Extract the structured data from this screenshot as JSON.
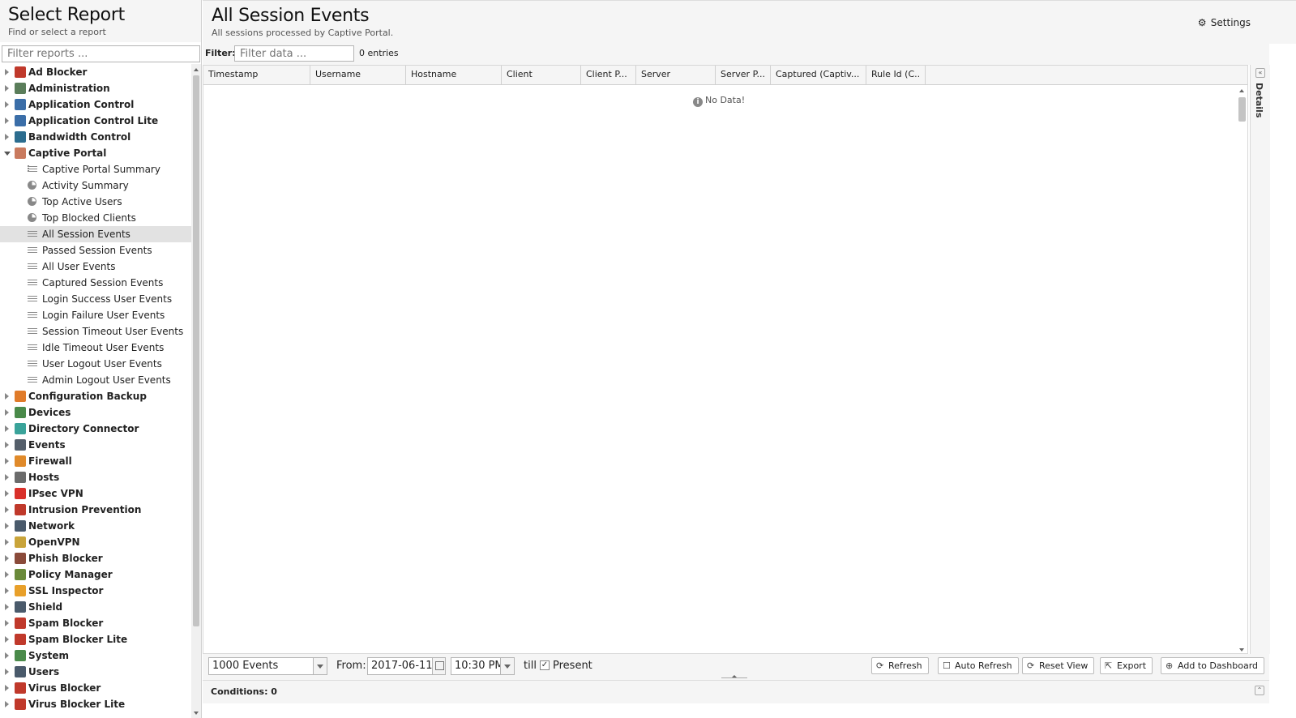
{
  "sidebar": {
    "title": "Select Report",
    "subtitle": "Find or select a report",
    "filter_placeholder": "Filter reports ...",
    "items": [
      {
        "label": "Ad Blocker",
        "type": "parent",
        "color": "#c0392b"
      },
      {
        "label": "Administration",
        "type": "parent",
        "color": "#5a7d5a"
      },
      {
        "label": "Application Control",
        "type": "parent",
        "color": "#3b6ea8"
      },
      {
        "label": "Application Control Lite",
        "type": "parent",
        "color": "#3b6ea8"
      },
      {
        "label": "Bandwidth Control",
        "type": "parent",
        "color": "#2c6d8f"
      },
      {
        "label": "Captive Portal",
        "type": "parent",
        "expanded": true,
        "color": "#c97a5e"
      },
      {
        "label": "Captive Portal Summary",
        "type": "child",
        "icon": "lines"
      },
      {
        "label": "Activity Summary",
        "type": "child",
        "icon": "pie"
      },
      {
        "label": "Top Active Users",
        "type": "child",
        "icon": "pie"
      },
      {
        "label": "Top Blocked Clients",
        "type": "child",
        "icon": "pie"
      },
      {
        "label": "All Session Events",
        "type": "child",
        "icon": "list",
        "selected": true
      },
      {
        "label": "Passed Session Events",
        "type": "child",
        "icon": "list"
      },
      {
        "label": "All User Events",
        "type": "child",
        "icon": "list"
      },
      {
        "label": "Captured Session Events",
        "type": "child",
        "icon": "list"
      },
      {
        "label": "Login Success User Events",
        "type": "child",
        "icon": "list"
      },
      {
        "label": "Login Failure User Events",
        "type": "child",
        "icon": "list"
      },
      {
        "label": "Session Timeout User Events",
        "type": "child",
        "icon": "list"
      },
      {
        "label": "Idle Timeout User Events",
        "type": "child",
        "icon": "list"
      },
      {
        "label": "User Logout User Events",
        "type": "child",
        "icon": "list"
      },
      {
        "label": "Admin Logout User Events",
        "type": "child",
        "icon": "list"
      },
      {
        "label": "Configuration Backup",
        "type": "parent",
        "color": "#e07b2a"
      },
      {
        "label": "Devices",
        "type": "parent",
        "color": "#4a8a4a"
      },
      {
        "label": "Directory Connector",
        "type": "parent",
        "color": "#3aa39a"
      },
      {
        "label": "Events",
        "type": "parent",
        "color": "#555f6b"
      },
      {
        "label": "Firewall",
        "type": "parent",
        "color": "#e08a2a"
      },
      {
        "label": "Hosts",
        "type": "parent",
        "color": "#6b6b6b"
      },
      {
        "label": "IPsec VPN",
        "type": "parent",
        "color": "#d9302a"
      },
      {
        "label": "Intrusion Prevention",
        "type": "parent",
        "color": "#c0392b"
      },
      {
        "label": "Network",
        "type": "parent",
        "color": "#4a5a6b"
      },
      {
        "label": "OpenVPN",
        "type": "parent",
        "color": "#c9a43a"
      },
      {
        "label": "Phish Blocker",
        "type": "parent",
        "color": "#8a4a3a"
      },
      {
        "label": "Policy Manager",
        "type": "parent",
        "color": "#6a8a3a"
      },
      {
        "label": "SSL Inspector",
        "type": "parent",
        "color": "#e8a02a"
      },
      {
        "label": "Shield",
        "type": "parent",
        "color": "#4a5a6b"
      },
      {
        "label": "Spam Blocker",
        "type": "parent",
        "color": "#c0392b"
      },
      {
        "label": "Spam Blocker Lite",
        "type": "parent",
        "color": "#c0392b"
      },
      {
        "label": "System",
        "type": "parent",
        "color": "#4a8a4a"
      },
      {
        "label": "Users",
        "type": "parent",
        "color": "#4a5a6b"
      },
      {
        "label": "Virus Blocker",
        "type": "parent",
        "color": "#c0392b"
      },
      {
        "label": "Virus Blocker Lite",
        "type": "parent",
        "color": "#c0392b"
      }
    ]
  },
  "main": {
    "title": "All Session Events",
    "subtitle": "All sessions processed by Captive Portal.",
    "settings_label": "Settings",
    "filter_label": "Filter:",
    "filter_placeholder": "Filter data ...",
    "entries": "0 entries",
    "columns": [
      "Timestamp",
      "Username",
      "Hostname",
      "Client",
      "Client P...",
      "Server",
      "Server P...",
      "Captured (Captiv...",
      "Rule Id (C.."
    ],
    "no_data": "No Data!",
    "details_label": "Details"
  },
  "toolbar": {
    "limit": "1000 Events",
    "from_label": "From:",
    "from_date": "2017-06-11",
    "from_time": "10:30 PM",
    "till_label": "till",
    "present_label": "Present",
    "present_checked": true,
    "refresh": "Refresh",
    "auto_refresh": "Auto Refresh",
    "reset_view": "Reset View",
    "export": "Export",
    "add_dashboard": "Add to Dashboard"
  },
  "conditions": {
    "label": "Conditions: 0"
  }
}
